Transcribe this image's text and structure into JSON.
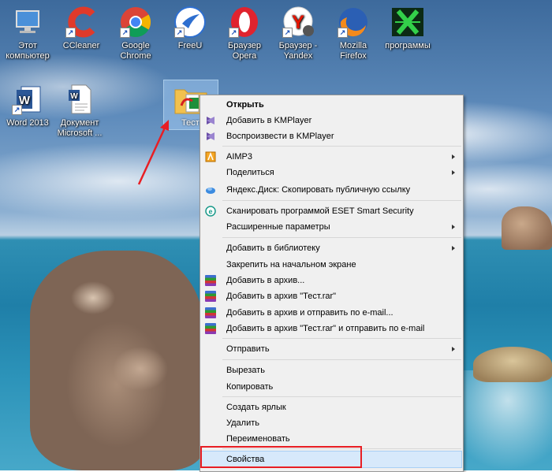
{
  "desktop": {
    "icons": [
      {
        "label": "Этот компьютер",
        "icon": "computer-icon"
      },
      {
        "label": "CCleaner",
        "icon": "ccleaner-icon"
      },
      {
        "label": "Google Chrome",
        "icon": "chrome-icon"
      },
      {
        "label": "FreeU",
        "icon": "freeu-icon"
      },
      {
        "label": "Браузер Opera",
        "icon": "opera-icon"
      },
      {
        "label": "Браузер - Yandex",
        "icon": "yandex-icon"
      },
      {
        "label": "Mozilla Firefox",
        "icon": "firefox-icon"
      },
      {
        "label": "программы",
        "icon": "programs-icon"
      },
      {
        "label": "Word 2013",
        "icon": "word-icon"
      },
      {
        "label": "Документ Microsoft ...",
        "icon": "document-icon"
      },
      {
        "label": "Тест",
        "icon": "folder-icon"
      }
    ]
  },
  "context_menu": {
    "items": [
      {
        "label": "Открыть",
        "bold": true
      },
      {
        "label": "Добавить в KMPlayer",
        "icon": "kmplayer-icon"
      },
      {
        "label": "Воспроизвести в KMPlayer",
        "icon": "kmplayer-icon"
      },
      {
        "label": "AIMP3",
        "icon": "aimp-icon",
        "submenu": true
      },
      {
        "label": "Поделиться",
        "submenu": true
      },
      {
        "label": "Яндекс.Диск: Скопировать публичную ссылку",
        "icon": "yandex-disk-icon"
      },
      {
        "label": "Сканировать программой ESET Smart Security",
        "icon": "eset-icon"
      },
      {
        "label": "Расширенные параметры",
        "submenu": true
      },
      {
        "label": "Добавить в библиотеку",
        "submenu": true
      },
      {
        "label": "Закрепить на начальном экране"
      },
      {
        "label": "Добавить в архив...",
        "icon": "winrar-icon"
      },
      {
        "label": "Добавить в архив \"Тест.rar\"",
        "icon": "winrar-icon"
      },
      {
        "label": "Добавить в архив и отправить по e-mail...",
        "icon": "winrar-icon"
      },
      {
        "label": "Добавить в архив \"Тест.rar\" и отправить по e-mail",
        "icon": "winrar-icon"
      },
      {
        "label": "Отправить",
        "submenu": true
      },
      {
        "label": "Вырезать"
      },
      {
        "label": "Копировать"
      },
      {
        "label": "Создать ярлык"
      },
      {
        "label": "Удалить"
      },
      {
        "label": "Переименовать"
      },
      {
        "label": "Свойства",
        "highlighted": true
      }
    ]
  },
  "colors": {
    "annotation_red": "#e81e24",
    "menu_highlight": "#d7e9fb"
  }
}
